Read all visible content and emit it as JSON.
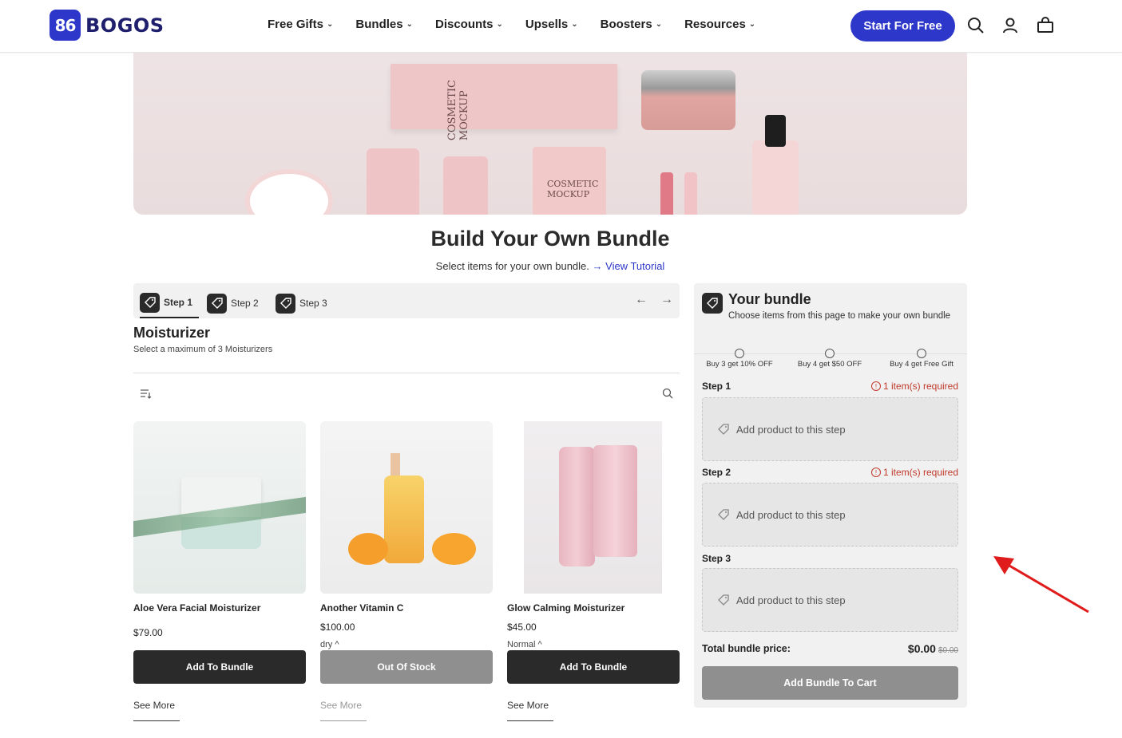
{
  "header": {
    "logo_mark": "86",
    "logo_text": "BOGOS",
    "nav": [
      "Free Gifts",
      "Bundles",
      "Discounts",
      "Upsells",
      "Boosters",
      "Resources"
    ],
    "cta": "Start For Free",
    "icons": [
      "search-icon",
      "account-icon",
      "cart-icon"
    ]
  },
  "hero": {
    "box_text": "COSMETIC MOCKUP",
    "sachet_text": "COSMETIC MOCKUP"
  },
  "page": {
    "title": "Build Your Own Bundle",
    "subtitle": "Select items for your own bundle.",
    "tutorial_link": "→ View Tutorial"
  },
  "steps": {
    "tabs": [
      "Step 1",
      "Step 2",
      "Step 3"
    ],
    "active_index": 0
  },
  "section": {
    "title": "Moisturizer",
    "subtitle": "Select a maximum of 3 Moisturizers"
  },
  "products": [
    {
      "name": "Aloe Vera Facial Moisturizer",
      "price": "$79.00",
      "variant": "",
      "button": "Add To Bundle",
      "button_state": "enabled",
      "see_more": "See More"
    },
    {
      "name": "Another Vitamin C",
      "price": "$100.00",
      "variant": "dry ^",
      "button": "Out Of Stock",
      "button_state": "disabled",
      "see_more": "See More"
    },
    {
      "name": "Glow Calming Moisturizer",
      "price": "$45.00",
      "variant": "Normal ^",
      "button": "Add To Bundle",
      "button_state": "enabled",
      "see_more": "See More"
    }
  ],
  "bundle": {
    "title": "Your bundle",
    "subtitle": "Choose items from this page to make your own bundle",
    "tiers": [
      "Buy 3 get 10% OFF",
      "Buy 4 get $50 OFF",
      "Buy 4 get Free Gift"
    ],
    "steps": [
      {
        "label": "Step 1",
        "required": "1 item(s) required",
        "slot": "Add product to this step"
      },
      {
        "label": "Step 2",
        "required": "1 item(s) required",
        "slot": "Add product to this step"
      },
      {
        "label": "Step 3",
        "required": "",
        "slot": "Add product to this step"
      }
    ],
    "total_label": "Total bundle price:",
    "total_value": "$0.00",
    "total_original": "$0.00",
    "cart_button": "Add Bundle To Cart"
  },
  "colors": {
    "brand": "#2d37c9",
    "dark_button": "#2a2a2a",
    "disabled_button": "#8f8f8f",
    "required_red": "#c0392b",
    "annotation_arrow": "#e01b1b"
  }
}
